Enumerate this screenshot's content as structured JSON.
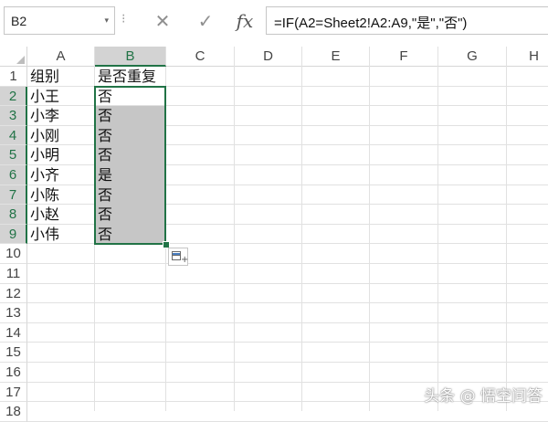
{
  "formula_bar": {
    "name_box": "B2",
    "name_box_arrow": "▾",
    "separator": "⁝",
    "cancel_glyph": "✕",
    "enter_glyph": "✓",
    "fx_glyph": "fx",
    "formula": "=IF(A2=Sheet2!A2:A9,\"是\",\"否\")"
  },
  "columns": [
    "A",
    "B",
    "C",
    "D",
    "E",
    "F",
    "G",
    "H"
  ],
  "selected_column": "B",
  "rows": [
    "1",
    "2",
    "3",
    "4",
    "5",
    "6",
    "7",
    "8",
    "9",
    "10",
    "11",
    "12",
    "13",
    "14",
    "15",
    "16",
    "17",
    "18"
  ],
  "cells": {
    "header": [
      "组别",
      "是否重复"
    ],
    "data": [
      [
        "小王",
        "否"
      ],
      [
        "小李",
        "否"
      ],
      [
        "小刚",
        "否"
      ],
      [
        "小明",
        "否"
      ],
      [
        "小齐",
        "是"
      ],
      [
        "小陈",
        "否"
      ],
      [
        "小赵",
        "否"
      ],
      [
        "小伟",
        "否"
      ]
    ]
  },
  "selection": "B2:B9",
  "watermark": "头条 @ 悟空问答",
  "colors": {
    "accent_green": "#217346",
    "selection_shade": "#c6c6c6"
  }
}
